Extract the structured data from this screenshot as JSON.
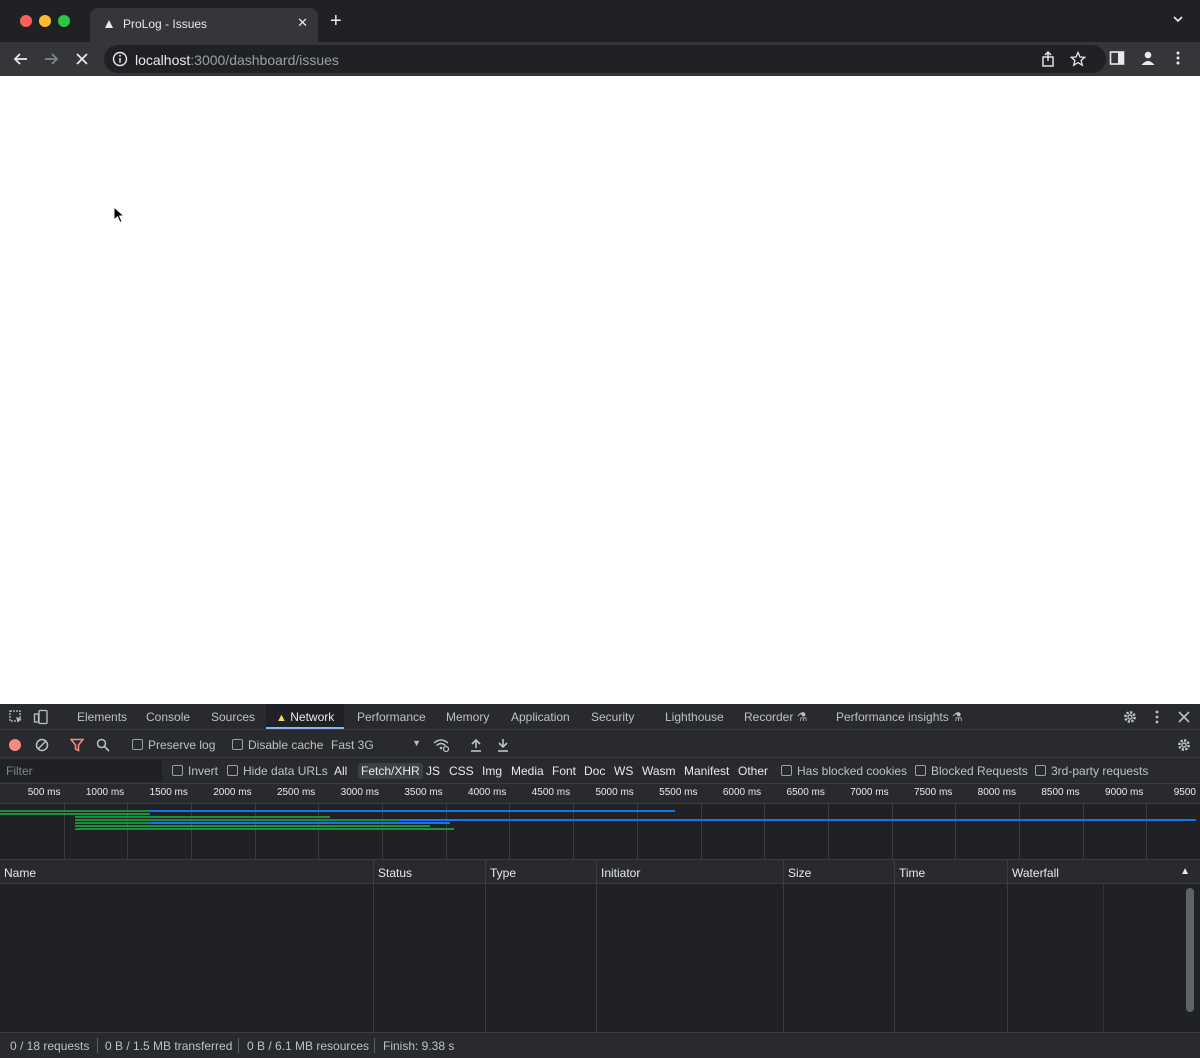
{
  "browser": {
    "tab": {
      "title": "ProLog - Issues",
      "favicon": "prolog-logo-icon"
    },
    "address": {
      "host": "localhost",
      "path": ":3000/dashboard/issues"
    },
    "icons": [
      "back-icon",
      "forward-icon",
      "stop-loading-icon",
      "site-info-icon",
      "share-icon",
      "bookmark-star-icon",
      "side-panel-icon",
      "profile-icon",
      "more-menu-icon"
    ]
  },
  "devtools": {
    "tabs": [
      {
        "label": "Elements"
      },
      {
        "label": "Console"
      },
      {
        "label": "Sources"
      },
      {
        "label": "Network",
        "active": true,
        "warning": true
      },
      {
        "label": "Performance"
      },
      {
        "label": "Memory"
      },
      {
        "label": "Application"
      },
      {
        "label": "Security"
      },
      {
        "label": "Lighthouse"
      },
      {
        "label": "Recorder ⚗"
      },
      {
        "label": "Performance insights ⚗"
      }
    ],
    "network": {
      "preserve_log": "Preserve log",
      "disable_cache": "Disable cache",
      "throttling": "Fast 3G",
      "filter_placeholder": "Filter",
      "invert": "Invert",
      "hide_data_urls": "Hide data URLs",
      "type_filters": [
        "All",
        "Fetch/XHR",
        "JS",
        "CSS",
        "Img",
        "Media",
        "Font",
        "Doc",
        "WS",
        "Wasm",
        "Manifest",
        "Other"
      ],
      "selected_type": "Fetch/XHR",
      "has_blocked_cookies": "Has blocked cookies",
      "blocked_requests": "Blocked Requests",
      "third_party": "3rd-party requests",
      "timeline_ticks": [
        "500 ms",
        "1000 ms",
        "1500 ms",
        "2000 ms",
        "2500 ms",
        "3000 ms",
        "3500 ms",
        "4000 ms",
        "4500 ms",
        "5000 ms",
        "5500 ms",
        "6000 ms",
        "6500 ms",
        "7000 ms",
        "7500 ms",
        "8000 ms",
        "8500 ms",
        "9000 ms",
        "9500"
      ],
      "columns": [
        "Name",
        "Status",
        "Type",
        "Initiator",
        "Size",
        "Time",
        "Waterfall"
      ],
      "status": {
        "requests": "0 / 18 requests",
        "transferred": "0 B / 1.5 MB transferred",
        "resources": "0 B / 6.1 MB resources",
        "finish": "Finish: 9.38 s"
      }
    }
  },
  "colors": {
    "waterfall_green": "#1e8e3e",
    "waterfall_blue": "#1a73e8",
    "accent": "#8ab4f8"
  }
}
